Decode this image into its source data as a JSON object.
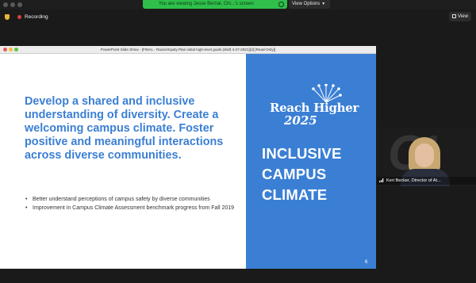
{
  "topbar": {
    "banner_text": "You are viewing Jesse Bernal, Chi...'s screen",
    "view_options_label": "View Options",
    "banner_color": "#2fbf4a"
  },
  "status": {
    "recording_label": "Recording",
    "view_button_label": "View"
  },
  "slideshow": {
    "window_title": "PowerPoint Slide Show - [FINAL - Racial Equity Plan initial high-level goals (draft 4-27-2021)[2] [Read-Only]]",
    "heading": "Develop a shared and inclusive understanding of diversity. Create a welcoming campus climate. Foster positive and meaningful interactions across diverse communities.",
    "bullets": [
      "Better understand perceptions of campus safety by diverse communities",
      "Improvement in Campus Climate Assessment benchmark progress from Fall 2019"
    ],
    "logo_line1": "Reach Higher",
    "logo_line2": "2025",
    "right_title": "INCLUSIVE CAMPUS CLIMATE",
    "slide_number": "6",
    "accent_color": "#3b7fd4"
  },
  "participant": {
    "name_label": "Keri Becker, Director of At..."
  }
}
